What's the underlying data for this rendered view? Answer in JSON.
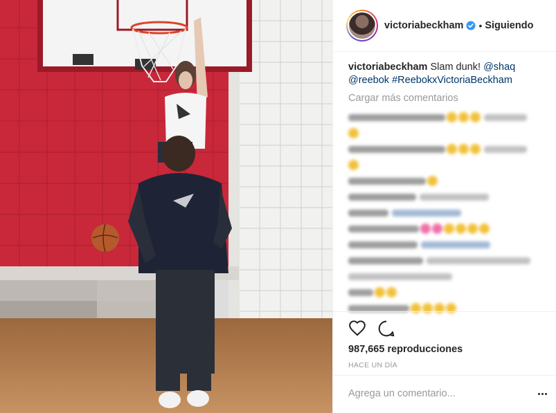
{
  "post": {
    "username": "victoriabeckham",
    "follow_status": "Siguiendo",
    "separator": "•",
    "verified_color": "#3897f0",
    "caption": {
      "username": "victoriabeckham",
      "text": "Slam dunk!",
      "mention_shaq": "@shaq",
      "mention_reebok": "@reebok",
      "hashtag": "#ReebokxVictoriaBeckham"
    },
    "load_more": "Cargar más comentarios",
    "views": "987,665 reproducciones",
    "timestamp": "HACE UN DÍA",
    "comment_placeholder": "Agrega un comentario...",
    "icons": {
      "like": "heart-icon",
      "comment": "comment-bubble-icon",
      "options": "more-horizontal-icon"
    },
    "colors": {
      "link": "#003569",
      "muted": "#999999",
      "text": "#262626",
      "wall_red": "#c8283a"
    }
  }
}
